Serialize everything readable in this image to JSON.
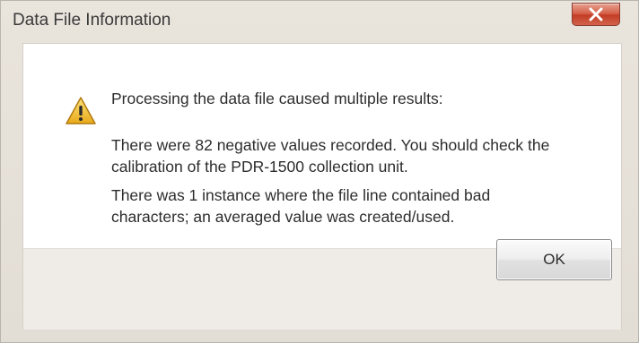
{
  "dialog": {
    "title": "Data File Information",
    "close_label": "X",
    "icon": "warning-icon",
    "message": {
      "heading": "Processing the data file caused multiple results:",
      "lines": [
        "There were 82 negative values recorded. You should check the",
        "calibration of the PDR-1500 collection unit.",
        "There was 1 instance where the file line contained bad",
        "characters; an averaged value was created/used."
      ]
    },
    "ok_label": "OK"
  },
  "colors": {
    "close_button": "#c84a33",
    "warning_fill": "#f2c230",
    "footer_bg": "#efece8"
  }
}
